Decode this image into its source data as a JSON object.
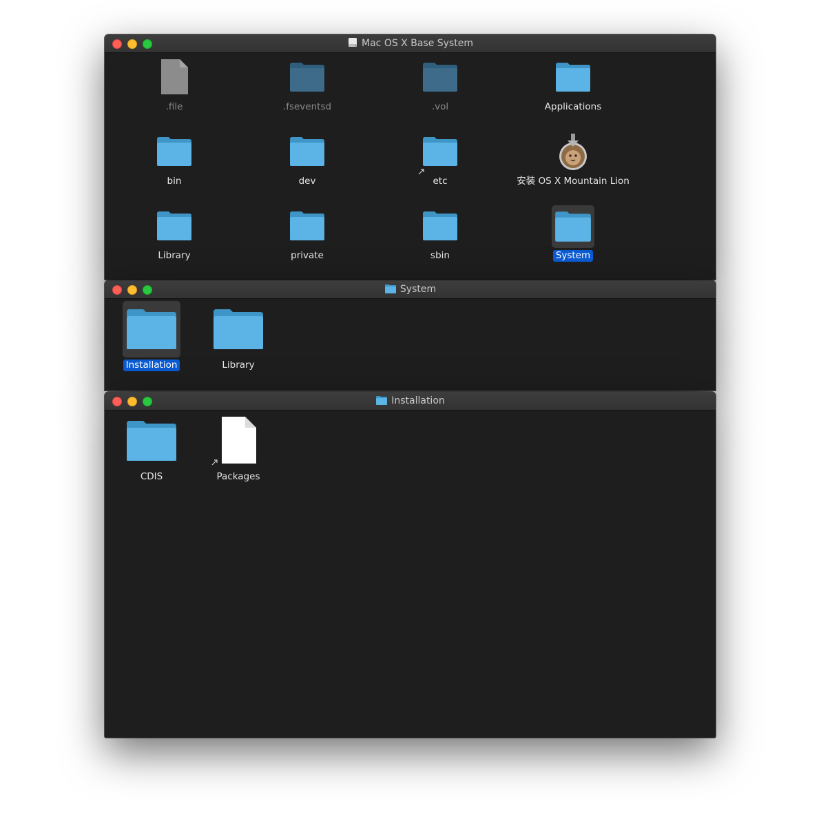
{
  "windows": [
    {
      "title": "Mac OS X Base System",
      "title_icon": "disk-icon",
      "items": [
        {
          "label": ".file",
          "icon": "document-icon",
          "dim": true
        },
        {
          "label": ".fseventsd",
          "icon": "folder-icon",
          "dim": true
        },
        {
          "label": ".vol",
          "icon": "folder-icon",
          "dim": true
        },
        {
          "label": "Applications",
          "icon": "folder-icon"
        },
        {
          "label": "bin",
          "icon": "folder-icon"
        },
        {
          "label": "dev",
          "icon": "folder-icon"
        },
        {
          "label": "etc",
          "icon": "folder-alias-icon"
        },
        {
          "label": "安装 OS X Mountain Lion",
          "icon": "mountain-lion-installer-icon"
        },
        {
          "label": "Library",
          "icon": "folder-icon"
        },
        {
          "label": "private",
          "icon": "folder-icon"
        },
        {
          "label": "sbin",
          "icon": "folder-icon"
        },
        {
          "label": "System",
          "icon": "folder-icon",
          "selected": true
        }
      ]
    },
    {
      "title": "System",
      "title_icon": "folder-icon",
      "items": [
        {
          "label": "Installation",
          "icon": "folder-icon",
          "selected": true
        },
        {
          "label": "Library",
          "icon": "folder-icon"
        }
      ]
    },
    {
      "title": "Installation",
      "title_icon": "folder-icon",
      "items": [
        {
          "label": "CDIS",
          "icon": "folder-icon"
        },
        {
          "label": "Packages",
          "icon": "document-alias-icon"
        }
      ]
    }
  ],
  "colors": {
    "window_bg": "#1e1e1e",
    "folder": "#5bb4e5",
    "selection": "#0b5bd3"
  }
}
